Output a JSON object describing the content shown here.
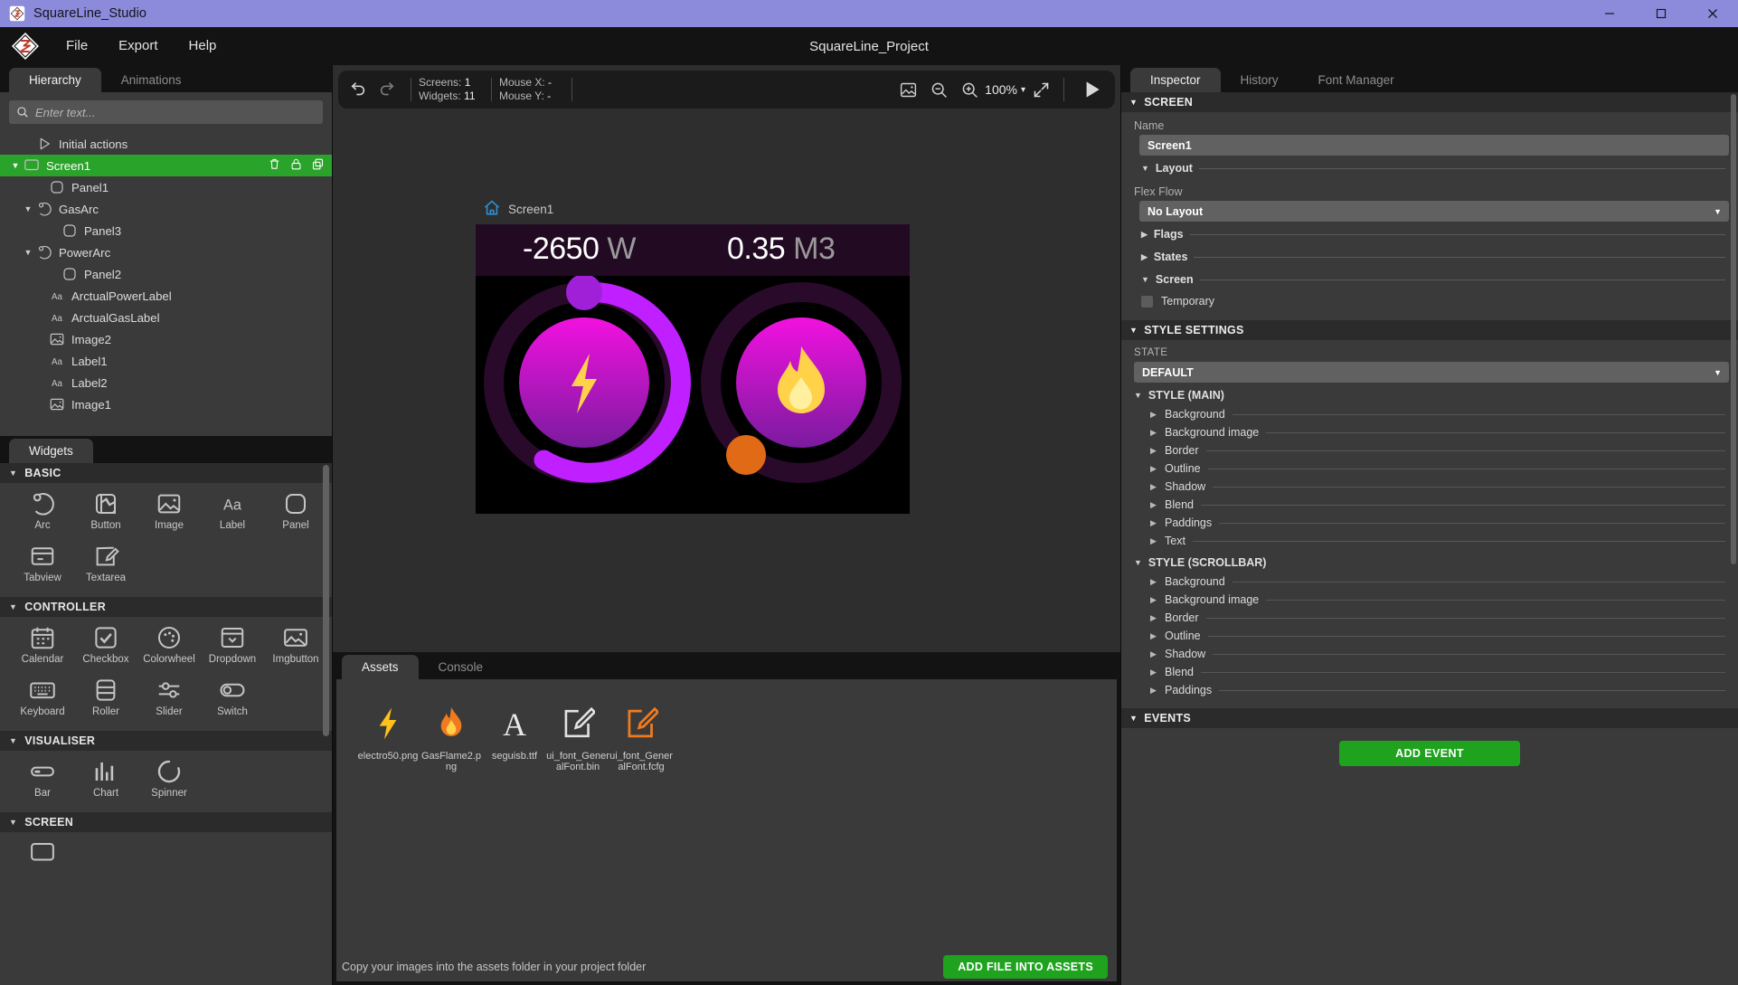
{
  "titlebar": {
    "app_name": "SquareLine_Studio",
    "logo_icon": "squareline-logo-icon",
    "minimize": "minimize-icon",
    "maximize": "maximize-icon",
    "close": "close-icon"
  },
  "menubar": {
    "brand_icon": "squareline-diamond-logo",
    "items": [
      {
        "label": "File"
      },
      {
        "label": "Export"
      },
      {
        "label": "Help"
      }
    ],
    "project_name": "SquareLine_Project"
  },
  "left_panel": {
    "tabs": [
      {
        "label": "Hierarchy",
        "active": true
      },
      {
        "label": "Animations",
        "active": false
      }
    ],
    "search": {
      "placeholder": "Enter text...",
      "value": "",
      "icon": "search-icon"
    },
    "tree": [
      {
        "label": "Initial actions",
        "icon": "play-triangle-icon",
        "indent": 1,
        "expander": "",
        "selected": false
      },
      {
        "label": "Screen1",
        "icon": "screen-icon",
        "indent": 0,
        "expander": "▼",
        "selected": true,
        "actions": [
          "delete-icon",
          "lock-icon",
          "duplicate-icon"
        ]
      },
      {
        "label": "Panel1",
        "icon": "panel-icon",
        "indent": 2,
        "expander": "",
        "selected": false
      },
      {
        "label": "GasArc",
        "icon": "arc-icon",
        "indent": 1,
        "expander": "▼",
        "selected": false
      },
      {
        "label": "Panel3",
        "icon": "panel-icon",
        "indent": 3,
        "expander": "",
        "selected": false
      },
      {
        "label": "PowerArc",
        "icon": "arc-icon",
        "indent": 1,
        "expander": "▼",
        "selected": false
      },
      {
        "label": "Panel2",
        "icon": "panel-icon",
        "indent": 3,
        "expander": "",
        "selected": false
      },
      {
        "label": "ArctualPowerLabel",
        "icon": "label-icon",
        "indent": 2,
        "expander": "",
        "selected": false
      },
      {
        "label": "ArctualGasLabel",
        "icon": "label-icon",
        "indent": 2,
        "expander": "",
        "selected": false
      },
      {
        "label": "Image2",
        "icon": "image-icon",
        "indent": 2,
        "expander": "",
        "selected": false
      },
      {
        "label": "Label1",
        "icon": "label-icon",
        "indent": 2,
        "expander": "",
        "selected": false
      },
      {
        "label": "Label2",
        "icon": "label-icon",
        "indent": 2,
        "expander": "",
        "selected": false
      },
      {
        "label": "Image1",
        "icon": "image-icon",
        "indent": 2,
        "expander": "",
        "selected": false
      }
    ]
  },
  "widgets_panel": {
    "tabs": [
      {
        "label": "Widgets",
        "active": true
      }
    ],
    "groups": [
      {
        "name": "BASIC",
        "expanded": true,
        "items": [
          {
            "label": "Arc",
            "icon": "arc-icon"
          },
          {
            "label": "Button",
            "icon": "button-icon"
          },
          {
            "label": "Image",
            "icon": "image-icon"
          },
          {
            "label": "Label",
            "icon": "label-aa-icon"
          },
          {
            "label": "Panel",
            "icon": "panel-icon"
          },
          {
            "label": "Tabview",
            "icon": "tabview-icon"
          },
          {
            "label": "Textarea",
            "icon": "textarea-pencil-icon"
          }
        ]
      },
      {
        "name": "CONTROLLER",
        "expanded": true,
        "items": [
          {
            "label": "Calendar",
            "icon": "calendar-icon"
          },
          {
            "label": "Checkbox",
            "icon": "checkbox-icon"
          },
          {
            "label": "Colorwheel",
            "icon": "colorwheel-icon"
          },
          {
            "label": "Dropdown",
            "icon": "dropdown-icon"
          },
          {
            "label": "Imgbutton",
            "icon": "imgbutton-icon"
          },
          {
            "label": "Keyboard",
            "icon": "keyboard-icon"
          },
          {
            "label": "Roller",
            "icon": "roller-icon"
          },
          {
            "label": "Slider",
            "icon": "slider-icon"
          },
          {
            "label": "Switch",
            "icon": "switch-icon"
          }
        ]
      },
      {
        "name": "VISUALISER",
        "expanded": true,
        "items": [
          {
            "label": "Bar",
            "icon": "bar-icon"
          },
          {
            "label": "Chart",
            "icon": "chart-icon"
          },
          {
            "label": "Spinner",
            "icon": "spinner-icon"
          }
        ]
      },
      {
        "name": "SCREEN",
        "expanded": true,
        "items": [
          {
            "label": "",
            "icon": "screen-icon"
          }
        ]
      }
    ]
  },
  "canvas_toolbar": {
    "undo_icon": "undo-icon",
    "redo_icon": "redo-icon",
    "screens_label": "Screens:",
    "screens_value": "1",
    "widgets_label": "Widgets:",
    "widgets_value": "11",
    "mouse_x_label": "Mouse X:",
    "mouse_x_value": "-",
    "mouse_y_label": "Mouse Y:",
    "mouse_y_value": "-",
    "screenshot_icon": "screenshot-icon",
    "zoom_out_icon": "zoom-out-icon",
    "zoom_in_icon": "zoom-in-icon",
    "zoom_level": "100%",
    "zoom_caret": "▾",
    "fit_icon": "fit-screen-icon",
    "play_icon": "play-icon"
  },
  "canvas": {
    "screen_label": "Screen1",
    "home_icon": "home-icon",
    "device": {
      "power_value": "-2650",
      "power_unit": "W",
      "gas_value": "0.35",
      "gas_unit": "M3",
      "power_icon": "lightning-bolt-icon",
      "gas_icon": "flame-icon",
      "power_arc_color": "#c020ff",
      "gas_arc_color": "#2a0a2a",
      "knob_color": "#a020d8",
      "gas_knob_color": "#e06a15",
      "bg_color": "#000000",
      "topbar_color": "#230a23"
    }
  },
  "bottom_panel": {
    "tabs": [
      {
        "label": "Assets",
        "active": true
      },
      {
        "label": "Console",
        "active": false
      }
    ],
    "assets": [
      {
        "name": "electro50.png",
        "icon": "lightning-bolt-icon"
      },
      {
        "name": "GasFlame2.png",
        "icon": "flame-icon"
      },
      {
        "name": "seguisb.ttf",
        "icon": "font-a-icon"
      },
      {
        "name": "ui_font_GeneralFont.bin",
        "icon": "file-edit-icon"
      },
      {
        "name": "ui_font_GeneralFont.fcfg",
        "icon": "file-edit-orange-icon"
      }
    ],
    "status_text": "Copy your images into the assets folder in your project folder",
    "add_file_label": "ADD FILE INTO ASSETS"
  },
  "inspector": {
    "tabs": [
      {
        "label": "Inspector",
        "active": true
      },
      {
        "label": "History",
        "active": false
      },
      {
        "label": "Font Manager",
        "active": false
      }
    ],
    "screen_section": {
      "header": "SCREEN",
      "name_label": "Name",
      "name_value": "Screen1",
      "layout_label": "Layout",
      "flex_flow_label": "Flex Flow",
      "flex_flow_value": "No Layout",
      "flags_label": "Flags",
      "states_label": "States",
      "screen_label": "Screen",
      "temporary_label": "Temporary",
      "temporary_checked": false
    },
    "style_settings": {
      "header": "STYLE SETTINGS",
      "state_label": "STATE",
      "state_value": "DEFAULT",
      "main_header": "STYLE (MAIN)",
      "main_props": [
        "Background",
        "Background image",
        "Border",
        "Outline",
        "Shadow",
        "Blend",
        "Paddings",
        "Text"
      ],
      "scrollbar_header": "STYLE (SCROLLBAR)",
      "scrollbar_props": [
        "Background",
        "Background image",
        "Border",
        "Outline",
        "Shadow",
        "Blend",
        "Paddings"
      ]
    },
    "events": {
      "header": "EVENTS",
      "add_event_label": "ADD EVENT"
    }
  },
  "colors": {
    "title_bar": "#8c8ada",
    "accent_green": "#2aa32a",
    "panel_bg": "#3a3a3a",
    "dark_bg": "#131313"
  }
}
